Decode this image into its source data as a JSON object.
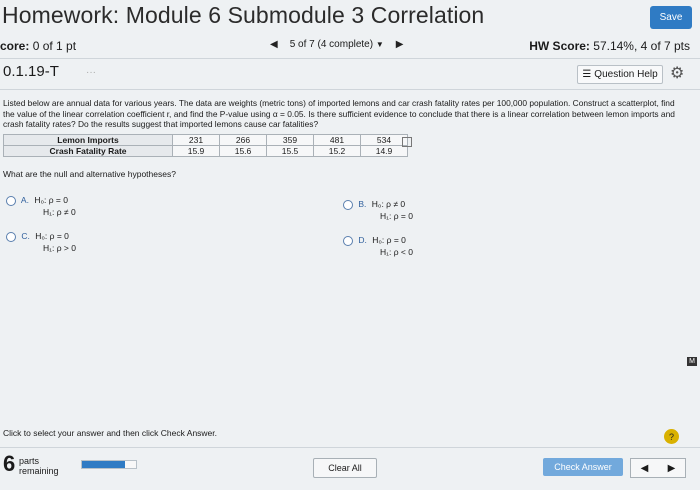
{
  "header": {
    "title": "Homework: Module 6 Submodule 3 Correlation",
    "save_label": "Save"
  },
  "score_row": {
    "score_label": "core:",
    "score_value": "0 of 1 pt",
    "progress_text": "5 of 7 (4 complete)",
    "hw_score_label": "HW Score:",
    "hw_score_value": "57.14%, 4 of 7 pts"
  },
  "question_header": {
    "id": "0.1.19-T",
    "help_label": "Question Help"
  },
  "question": {
    "text": "Listed below are annual data for various years. The data are weights (metric tons) of imported lemons and car crash fatality rates per 100,000 population. Construct a scatterplot, find the value of the linear correlation coefficient r, and find the P-value using α = 0.05. Is there sufficient evidence to conclude that there is a linear correlation between lemon imports and crash fatality rates? Do the results suggest that imported lemons cause car fatalities?",
    "table": {
      "rows": [
        {
          "label": "Lemon Imports",
          "values": [
            "231",
            "266",
            "359",
            "481",
            "534"
          ]
        },
        {
          "label": "Crash Fatality Rate",
          "values": [
            "15.9",
            "15.6",
            "15.5",
            "15.2",
            "14.9"
          ]
        }
      ]
    },
    "sub_question": "What are the null and alternative hypotheses?",
    "options": [
      {
        "letter": "A.",
        "h0": "H₀: ρ = 0",
        "h1": "H₁: ρ ≠ 0"
      },
      {
        "letter": "B.",
        "h0": "H₀: ρ ≠ 0",
        "h1": "H₁: ρ = 0"
      },
      {
        "letter": "C.",
        "h0": "H₀: ρ = 0",
        "h1": "H₁: ρ > 0"
      },
      {
        "letter": "D.",
        "h0": "H₀: ρ = 0",
        "h1": "H₁: ρ < 0"
      }
    ]
  },
  "footer": {
    "instruction": "Click to select your answer and then click Check Answer.",
    "parts_number": "6",
    "parts_label_1": "parts",
    "parts_label_2": "remaining",
    "parts_progress": 0.8,
    "clear_label": "Clear All",
    "check_label": "Check Answer",
    "help_icon": "?",
    "edge_label": "M"
  },
  "colors": {
    "accent": "#2f7bc4",
    "check_button": "#72a9dc",
    "help_icon": "#d9b100"
  }
}
